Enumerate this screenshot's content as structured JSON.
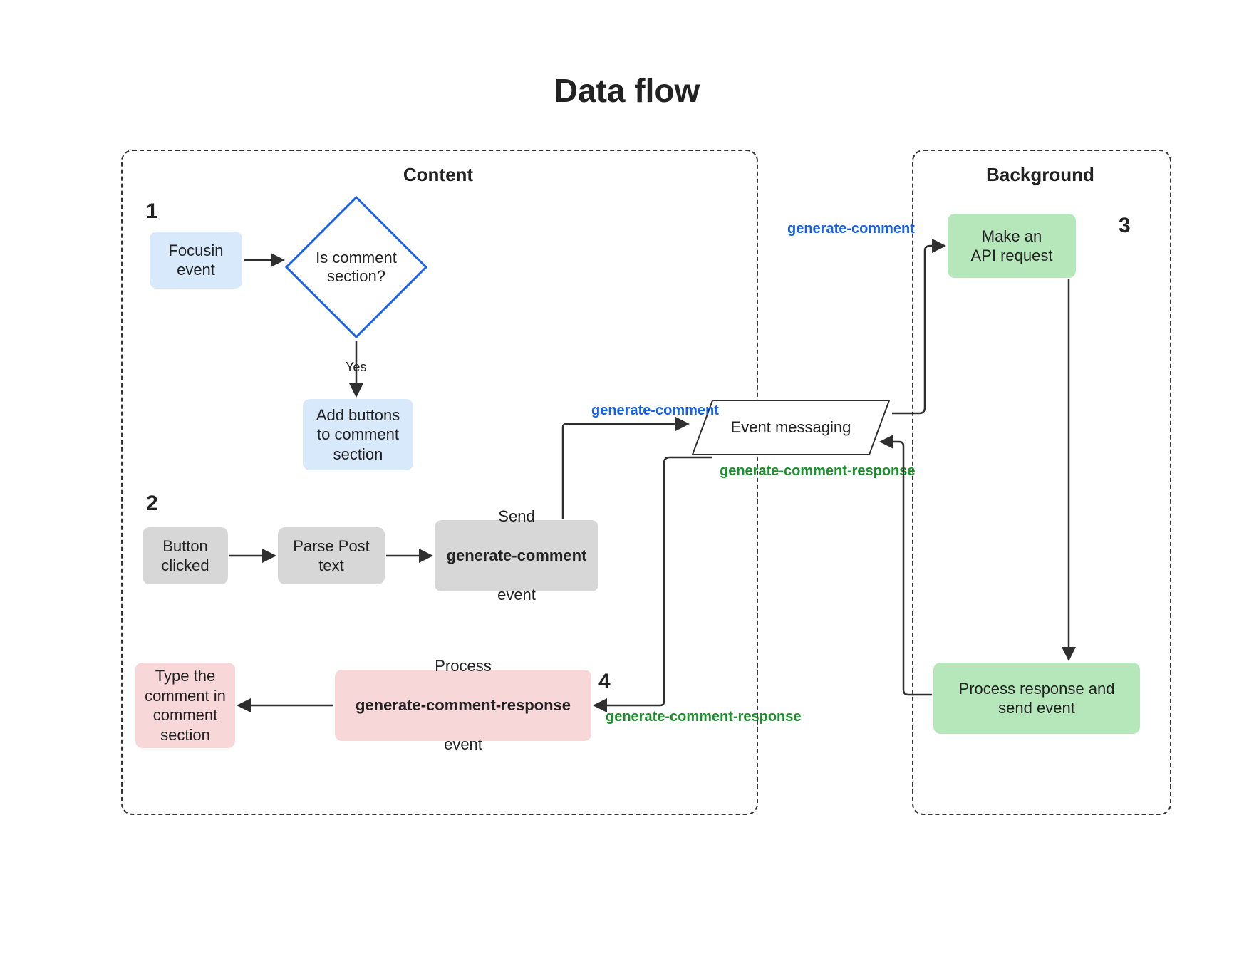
{
  "title": "Data flow",
  "groups": {
    "content": "Content",
    "background": "Background"
  },
  "steps": {
    "s1": "1",
    "s2": "2",
    "s3": "3",
    "s4": "4"
  },
  "nodes": {
    "focusin": "Focusin\nevent",
    "decision": "Is comment\nsection?",
    "yes": "Yes",
    "addButtons": "Add buttons\nto comment\nsection",
    "buttonClicked": "Button\nclicked",
    "parsePost": "Parse Post\ntext",
    "sendEvent_pre": "Send",
    "sendEvent_bold": "generate-comment",
    "sendEvent_post": "event",
    "processResp_pre": "Process",
    "processResp_bold": "generate-comment-response",
    "processResp_post": "event",
    "typeComment": "Type the\ncomment in\ncomment\nsection",
    "eventMessaging": "Event messaging",
    "apiRequest": "Make an\nAPI request",
    "processSend": "Process response and\nsend event"
  },
  "edgeLabels": {
    "genComment1": "generate-comment",
    "genComment2": "generate-comment",
    "genRespTop": "generate-comment-response",
    "genRespBottom": "generate-comment-response"
  },
  "colors": {
    "blueAccent": "#1760ea",
    "greenAccent": "#1a8f2b",
    "arrow": "#2f2f2f"
  }
}
